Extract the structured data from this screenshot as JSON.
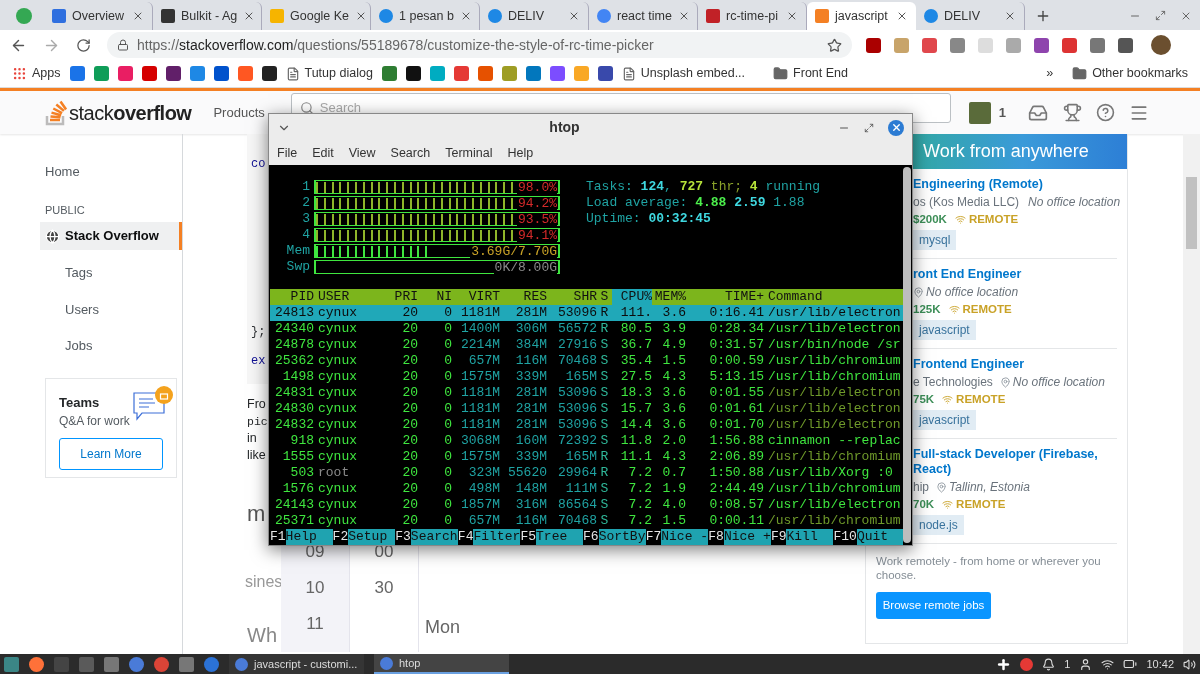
{
  "browser": {
    "tabs": [
      {
        "title": "Overview",
        "selected": false
      },
      {
        "title": "Bulkit - Ag",
        "selected": false
      },
      {
        "title": "Google Ke",
        "selected": false
      },
      {
        "title": "1 pesan b",
        "selected": false
      },
      {
        "title": "DELIV",
        "selected": false
      },
      {
        "title": "react time",
        "selected": false
      },
      {
        "title": "rc-time-pi",
        "selected": false
      },
      {
        "title": "javascript",
        "selected": true
      },
      {
        "title": "DELIV",
        "selected": false
      }
    ],
    "url": {
      "scheme": "https://",
      "host": "stackoverflow.com",
      "path": "/questions/55189678/customize-the-style-of-rc-time-picker"
    },
    "bookmarks": [
      {
        "kind": "apps",
        "label": "Apps"
      },
      {
        "kind": "page",
        "label": "Tutup dialog"
      },
      {
        "kind": "page",
        "label": "Unsplash embed..."
      },
      {
        "kind": "folder",
        "label": "Front End"
      }
    ],
    "overflow": "»",
    "other_bookmarks": "Other bookmarks"
  },
  "site": {
    "logo_light": "stack",
    "logo_bold": "overflow",
    "nav": "Products",
    "search_placeholder": "Search",
    "reputation": "1",
    "sidebar": [
      {
        "kind": "top",
        "label": "Home",
        "selected": false
      },
      {
        "kind": "heading",
        "label": "PUBLIC"
      },
      {
        "kind": "site",
        "label": "Stack Overflow",
        "selected": true
      },
      {
        "kind": "sub",
        "label": "Tags",
        "selected": false
      },
      {
        "kind": "sub",
        "label": "Users",
        "selected": false
      },
      {
        "kind": "sub",
        "label": "Jobs",
        "selected": false
      }
    ],
    "teams": {
      "title": "Teams",
      "subtitle": "Q&A for work",
      "button": "Learn More"
    },
    "code_fragments": [
      "co",
      "};",
      "ex"
    ],
    "text_fragments": [
      "Fro",
      "pic",
      "in",
      "like"
    ],
    "heading_fragments": [
      "m",
      "sines",
      "Wh"
    ],
    "picker": {
      "hours": [
        "09",
        "10",
        "11"
      ],
      "minutes": [
        "00",
        "30"
      ],
      "day": "Mon"
    },
    "jobs_banner": "Work from anywhere",
    "jobs": [
      {
        "title": "Engineering (Remote)",
        "company": "os (Kos Media LLC)",
        "location": "No office location",
        "salary": "$200K",
        "remote": "REMOTE",
        "tag": "mysql"
      },
      {
        "title": "ront End Engineer",
        "location": "No office location",
        "salary": "125K",
        "remote": "REMOTE",
        "tag": "javascript"
      },
      {
        "title": "Frontend Engineer",
        "company": "e Technologies",
        "location": "No office location",
        "salary": "75K",
        "remote": "REMOTE",
        "tag": "javascript"
      },
      {
        "title": "Full-stack Developer (Firebase, React)",
        "company": "hip",
        "location": "Tallinn, Estonia",
        "salary": "70K",
        "remote": "REMOTE",
        "tag": "node.js"
      }
    ],
    "jobs_footer": "Work remotely - from home or wherever you choose.",
    "jobs_button": "Browse remote jobs"
  },
  "htop": {
    "title": "htop",
    "menu": [
      "File",
      "Edit",
      "View",
      "Search",
      "Terminal",
      "Help"
    ],
    "meters": [
      {
        "kind": "cpu",
        "label": "1",
        "level": 0.98,
        "reading": "98.0%"
      },
      {
        "kind": "cpu",
        "label": "2",
        "level": 0.94,
        "reading": "94.2%"
      },
      {
        "kind": "cpu",
        "label": "3",
        "level": 0.93,
        "reading": "93.5%"
      },
      {
        "kind": "cpu",
        "label": "4",
        "level": 0.94,
        "reading": "94.1%"
      },
      {
        "kind": "mem",
        "label": "Mem",
        "level": 0.48,
        "reading": "3.69G/7.70G"
      },
      {
        "kind": "swap",
        "label": "Swp",
        "reading": "0K/8.00G"
      }
    ],
    "stats": [
      [
        {
          "text": "Tasks: ",
          "kind": "label"
        },
        {
          "text": "124",
          "kind": "value"
        },
        {
          "text": ", ",
          "kind": "label"
        },
        {
          "text": "727",
          "kind": "accent"
        },
        {
          "text": " thr; ",
          "kind": "dim"
        },
        {
          "text": "4",
          "kind": "accent"
        },
        {
          "text": " running",
          "kind": "label"
        }
      ],
      [
        {
          "text": "Load average: ",
          "kind": "label"
        },
        {
          "text": "4.88 ",
          "kind": "high"
        },
        {
          "text": "2.59 ",
          "kind": "value"
        },
        {
          "text": "1.88",
          "kind": "low"
        }
      ],
      [
        {
          "text": "Uptime: ",
          "kind": "label"
        },
        {
          "text": "00:32:45",
          "kind": "value"
        }
      ]
    ],
    "columns": [
      {
        "label": "PID",
        "sorted": false
      },
      {
        "label": "USER",
        "sorted": false
      },
      {
        "label": "PRI",
        "sorted": false
      },
      {
        "label": "NI",
        "sorted": false
      },
      {
        "label": "VIRT",
        "sorted": false
      },
      {
        "label": "RES",
        "sorted": false
      },
      {
        "label": "SHR",
        "sorted": false
      },
      {
        "label": "S",
        "sorted": false
      },
      {
        "label": "CPU%",
        "sorted": true
      },
      {
        "label": "MEM%",
        "sorted": false
      },
      {
        "label": "TIME+",
        "sorted": false
      },
      {
        "label": "Command",
        "sorted": false
      }
    ],
    "rows": [
      {
        "selected": true,
        "thread": false,
        "other_user": false,
        "cells": [
          "24813",
          "cynux",
          "20",
          "0",
          "1181M",
          "281M",
          "53096",
          "R",
          "111.",
          "3.6",
          "0:16.41",
          "/usr/lib/electron"
        ]
      },
      {
        "selected": false,
        "thread": false,
        "other_user": false,
        "cells": [
          "24340",
          "cynux",
          "20",
          "0",
          "1400M",
          "306M",
          "56572",
          "R",
          "80.5",
          "3.9",
          "0:28.34",
          "/usr/lib/electron"
        ]
      },
      {
        "selected": false,
        "thread": false,
        "other_user": false,
        "cells": [
          "24878",
          "cynux",
          "20",
          "0",
          "2214M",
          "384M",
          "27916",
          "S",
          "36.7",
          "4.9",
          "0:31.57",
          "/usr/bin/node /sr"
        ]
      },
      {
        "selected": false,
        "thread": false,
        "other_user": false,
        "cells": [
          "25362",
          "cynux",
          "20",
          "0",
          "657M",
          "116M",
          "70468",
          "S",
          "35.4",
          "1.5",
          "0:00.59",
          "/usr/lib/chromium"
        ]
      },
      {
        "selected": false,
        "thread": false,
        "other_user": false,
        "cells": [
          "1498",
          "cynux",
          "20",
          "0",
          "1575M",
          "339M",
          "165M",
          "S",
          "27.5",
          "4.3",
          "5:13.15",
          "/usr/lib/chromium"
        ]
      },
      {
        "selected": false,
        "thread": true,
        "other_user": false,
        "cells": [
          "24831",
          "cynux",
          "20",
          "0",
          "1181M",
          "281M",
          "53096",
          "S",
          "18.3",
          "3.6",
          "0:01.55",
          "/usr/lib/electron"
        ]
      },
      {
        "selected": false,
        "thread": true,
        "other_user": false,
        "cells": [
          "24830",
          "cynux",
          "20",
          "0",
          "1181M",
          "281M",
          "53096",
          "S",
          "15.7",
          "3.6",
          "0:01.61",
          "/usr/lib/electron"
        ]
      },
      {
        "selected": false,
        "thread": true,
        "other_user": false,
        "cells": [
          "24832",
          "cynux",
          "20",
          "0",
          "1181M",
          "281M",
          "53096",
          "S",
          "14.4",
          "3.6",
          "0:01.70",
          "/usr/lib/electron"
        ]
      },
      {
        "selected": false,
        "thread": false,
        "other_user": false,
        "cells": [
          "918",
          "cynux",
          "20",
          "0",
          "3068M",
          "160M",
          "72392",
          "S",
          "11.8",
          "2.0",
          "1:56.88",
          "cinnamon --replac"
        ]
      },
      {
        "selected": false,
        "thread": true,
        "other_user": false,
        "cells": [
          "1555",
          "cynux",
          "20",
          "0",
          "1575M",
          "339M",
          "165M",
          "R",
          "11.1",
          "4.3",
          "2:06.89",
          "/usr/lib/chromium"
        ]
      },
      {
        "selected": false,
        "thread": false,
        "other_user": true,
        "cells": [
          "503",
          "root",
          "20",
          "0",
          "323M",
          "55620",
          "29964",
          "R",
          "7.2",
          "0.7",
          "1:50.88",
          "/usr/lib/Xorg :0"
        ]
      },
      {
        "selected": false,
        "thread": false,
        "other_user": false,
        "cells": [
          "1576",
          "cynux",
          "20",
          "0",
          "498M",
          "148M",
          "111M",
          "S",
          "7.2",
          "1.9",
          "2:44.49",
          "/usr/lib/chromium"
        ]
      },
      {
        "selected": false,
        "thread": false,
        "other_user": false,
        "cells": [
          "24143",
          "cynux",
          "20",
          "0",
          "1857M",
          "316M",
          "86564",
          "S",
          "7.2",
          "4.0",
          "0:08.57",
          "/usr/lib/electron"
        ]
      },
      {
        "selected": false,
        "thread": true,
        "other_user": false,
        "cells": [
          "25371",
          "cynux",
          "20",
          "0",
          "657M",
          "116M",
          "70468",
          "S",
          "7.2",
          "1.5",
          "0:00.11",
          "/usr/lib/chromium"
        ]
      }
    ],
    "function_keys": [
      {
        "key": "F1",
        "label": "Help"
      },
      {
        "key": "F2",
        "label": "Setup"
      },
      {
        "key": "F3",
        "label": "Search"
      },
      {
        "key": "F4",
        "label": "Filter"
      },
      {
        "key": "F5",
        "label": "Tree"
      },
      {
        "key": "F6",
        "label": "SortBy"
      },
      {
        "key": "F7",
        "label": "Nice -"
      },
      {
        "key": "F8",
        "label": "Nice +"
      },
      {
        "key": "F9",
        "label": "Kill"
      },
      {
        "key": "F10",
        "label": "Quit"
      }
    ]
  },
  "taskbar": {
    "windows": [
      {
        "title": "javascript - customi...",
        "selected": false
      },
      {
        "title": "htop",
        "selected": true
      }
    ],
    "notifications": "1",
    "time": "10:42"
  }
}
